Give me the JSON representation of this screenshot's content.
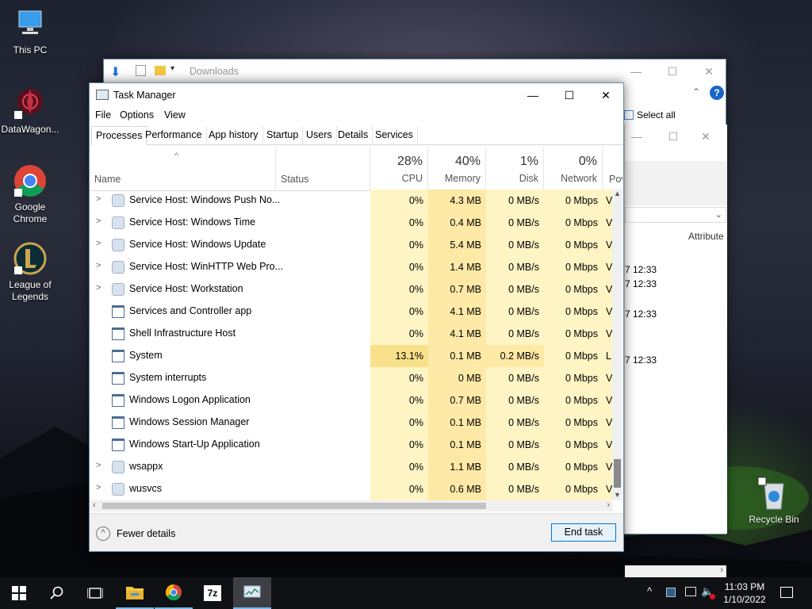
{
  "desktop": {
    "icons": [
      {
        "label": "This PC"
      },
      {
        "label": "DataWagon..."
      },
      {
        "label": "Google Chrome"
      },
      {
        "label": "League of Legends"
      },
      {
        "label": "Recycle Bin"
      }
    ]
  },
  "explorer": {
    "title": "Downloads",
    "select_all": "Select all",
    "attributes": "Attribute",
    "times": [
      "7 12:33",
      "7 12:33",
      "7 12:33",
      "7 12:33"
    ]
  },
  "task_manager": {
    "title": "Task Manager",
    "menu": [
      "File",
      "Options",
      "View"
    ],
    "tabs": [
      "Processes",
      "Performance",
      "App history",
      "Startup",
      "Users",
      "Details",
      "Services"
    ],
    "columns": {
      "name": "Name",
      "status": "Status",
      "cpu": {
        "pct": "28%",
        "label": "CPU"
      },
      "memory": {
        "pct": "40%",
        "label": "Memory"
      },
      "disk": {
        "pct": "1%",
        "label": "Disk"
      },
      "network": {
        "pct": "0%",
        "label": "Network"
      },
      "power": "Pov"
    },
    "rows": [
      {
        "name": "Service Host: Windows Push No...",
        "cpu": "0%",
        "memory": "4.3 MB",
        "disk": "0 MB/s",
        "network": "0 Mbps",
        "power": "V"
      },
      {
        "name": "Service Host: Windows Time",
        "cpu": "0%",
        "memory": "0.4 MB",
        "disk": "0 MB/s",
        "network": "0 Mbps",
        "power": "V"
      },
      {
        "name": "Service Host: Windows Update",
        "cpu": "0%",
        "memory": "5.4 MB",
        "disk": "0 MB/s",
        "network": "0 Mbps",
        "power": "V"
      },
      {
        "name": "Service Host: WinHTTP Web Pro...",
        "cpu": "0%",
        "memory": "1.4 MB",
        "disk": "0 MB/s",
        "network": "0 Mbps",
        "power": "V"
      },
      {
        "name": "Service Host: Workstation",
        "cpu": "0%",
        "memory": "0.7 MB",
        "disk": "0 MB/s",
        "network": "0 Mbps",
        "power": "V"
      },
      {
        "name": "Services and Controller app",
        "cpu": "0%",
        "memory": "4.1 MB",
        "disk": "0 MB/s",
        "network": "0 Mbps",
        "power": "V"
      },
      {
        "name": "Shell Infrastructure Host",
        "cpu": "0%",
        "memory": "4.1 MB",
        "disk": "0 MB/s",
        "network": "0 Mbps",
        "power": "V"
      },
      {
        "name": "System",
        "cpu": "13.1%",
        "memory": "0.1 MB",
        "disk": "0.2 MB/s",
        "network": "0 Mbps",
        "power": "L"
      },
      {
        "name": "System interrupts",
        "cpu": "0%",
        "memory": "0 MB",
        "disk": "0 MB/s",
        "network": "0 Mbps",
        "power": "V"
      },
      {
        "name": "Windows Logon Application",
        "cpu": "0%",
        "memory": "0.7 MB",
        "disk": "0 MB/s",
        "network": "0 Mbps",
        "power": "V"
      },
      {
        "name": "Windows Session Manager",
        "cpu": "0%",
        "memory": "0.1 MB",
        "disk": "0 MB/s",
        "network": "0 Mbps",
        "power": "V"
      },
      {
        "name": "Windows Start-Up Application",
        "cpu": "0%",
        "memory": "0.1 MB",
        "disk": "0 MB/s",
        "network": "0 Mbps",
        "power": "V"
      },
      {
        "name": "wsappx",
        "cpu": "0%",
        "memory": "1.1 MB",
        "disk": "0 MB/s",
        "network": "0 Mbps",
        "power": "V"
      },
      {
        "name": "wusvcs",
        "cpu": "0%",
        "memory": "0.6 MB",
        "disk": "0 MB/s",
        "network": "0 Mbps",
        "power": "V"
      }
    ],
    "fewer_details": "Fewer details",
    "end_task": "End task"
  },
  "taskbar": {
    "time": "11:03 PM",
    "date": "1/10/2022",
    "apps": [
      "start-icon",
      "search-icon",
      "task-view-icon",
      "file-explorer-icon",
      "chrome-icon",
      "7zip-icon",
      "task-manager-icon"
    ]
  },
  "colors": {
    "accent": "#0078d7",
    "heat_light": "#fff4c4",
    "heat_medium": "#ffe9a6",
    "heat_strong": "#f9e08a"
  }
}
